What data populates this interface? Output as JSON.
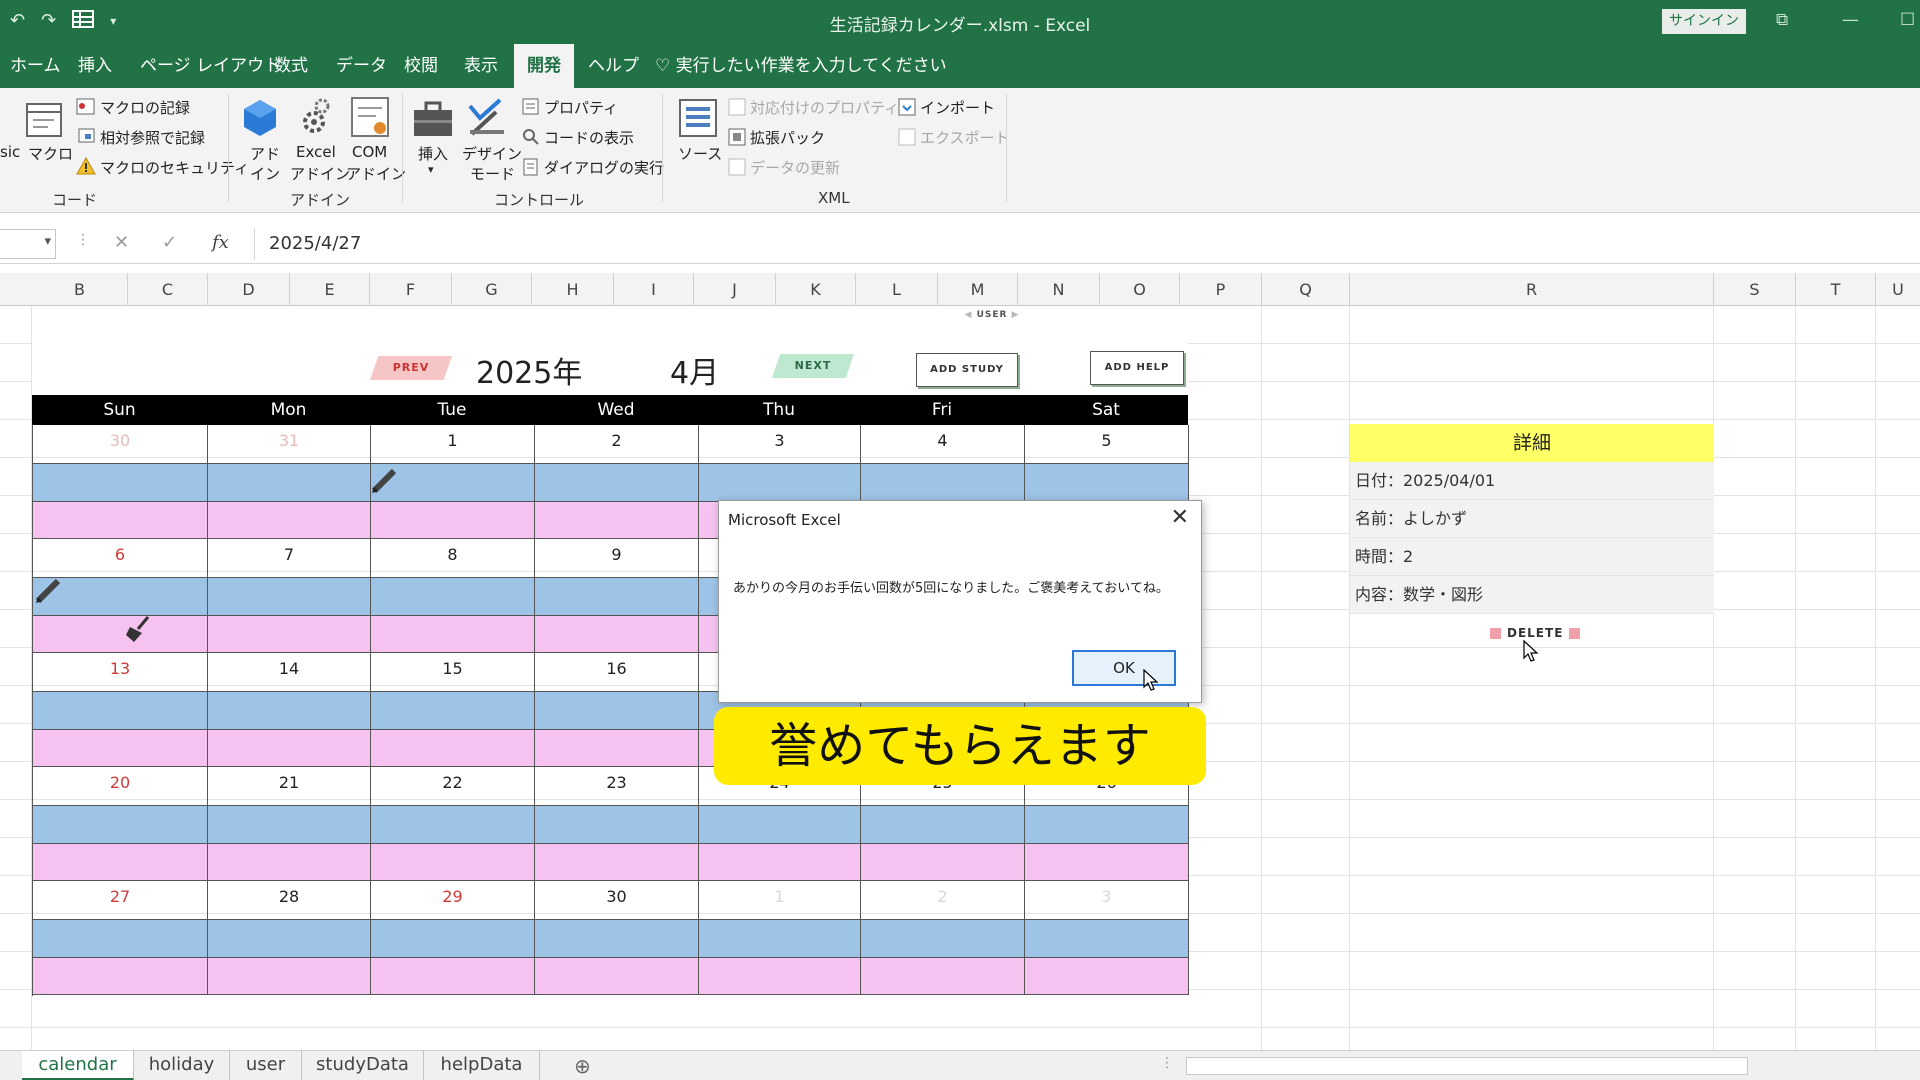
{
  "window": {
    "title": "生活記録カレンダー.xlsm  -  Excel",
    "signin": "サインイン"
  },
  "tabs": [
    {
      "label": "ホーム"
    },
    {
      "label": "挿入"
    },
    {
      "label": "ページ レイアウト"
    },
    {
      "label": "数式"
    },
    {
      "label": "データ"
    },
    {
      "label": "校閲"
    },
    {
      "label": "表示"
    },
    {
      "label": "開発"
    },
    {
      "label": "ヘルプ"
    }
  ],
  "tellme": "実行したい作業を入力してください",
  "ribbon": {
    "code": {
      "basic": "sic",
      "macro": "マクロ",
      "record": "マクロの記録",
      "relative": "相対参照で記録",
      "security": "マクロのセキュリティ",
      "group": "コード"
    },
    "addins": {
      "addin1": "アド",
      "addin2": "イン",
      "excel1": "Excel",
      "excel2": "アドイン",
      "com1": "COM",
      "com2": "アドイン",
      "group": "アドイン"
    },
    "controls": {
      "insert": "挿入",
      "design1": "デザイン",
      "design2": "モード",
      "properties": "プロパティ",
      "viewcode": "コードの表示",
      "rundialog": "ダイアログの実行",
      "group": "コントロール"
    },
    "xml": {
      "source": "ソース",
      "mapprops": "対応付けのプロパティ",
      "expansion": "拡張パック",
      "refresh": "データの更新",
      "import": "インポート",
      "export": "エクスポート",
      "group": "XML"
    }
  },
  "formula": {
    "value": "2025/4/27"
  },
  "columns": [
    "B",
    "C",
    "D",
    "E",
    "F",
    "G",
    "H",
    "I",
    "J",
    "K",
    "L",
    "M",
    "N",
    "O",
    "P",
    "Q",
    "R",
    "S",
    "T",
    "U"
  ],
  "calendar": {
    "year": "2025年",
    "month": "4月",
    "prev": "PREV",
    "next": "NEXT",
    "user": "USER",
    "add_study": "ADD STUDY",
    "add_help": "ADD HELP",
    "dow": [
      "Sun",
      "Mon",
      "Tue",
      "Wed",
      "Thu",
      "Fri",
      "Sat"
    ],
    "weeks": [
      [
        "30",
        "31",
        "1",
        "2",
        "3",
        "4",
        "5"
      ],
      [
        "6",
        "7",
        "8",
        "9",
        "",
        "",
        ""
      ],
      [
        "13",
        "14",
        "15",
        "16",
        "",
        "",
        ""
      ],
      [
        "20",
        "21",
        "22",
        "23",
        "24",
        "25",
        "26"
      ],
      [
        "27",
        "28",
        "29",
        "30",
        "1",
        "2",
        "3"
      ]
    ]
  },
  "detail": {
    "header": "詳細",
    "date": "日付：2025/04/01",
    "name": "名前：よしかず",
    "time": "時間：2",
    "content": "内容：数学・図形",
    "delete": "DELETE"
  },
  "dialog": {
    "title": "Microsoft Excel",
    "message": "あかりの今月のお手伝い回数が5回になりました。ご褒美考えておいてね。",
    "ok": "OK"
  },
  "caption": "誉めてもらえます",
  "sheets": [
    {
      "label": "calendar"
    },
    {
      "label": "holiday"
    },
    {
      "label": "user"
    },
    {
      "label": "studyData"
    },
    {
      "label": "helpData"
    }
  ],
  "colors": {
    "excel_green": "#217346",
    "cal_blue": "#9dc3e6",
    "cal_pink": "#f6c2f0",
    "detail_yellow": "#ffff66",
    "caption_yellow": "#ffeb00"
  }
}
